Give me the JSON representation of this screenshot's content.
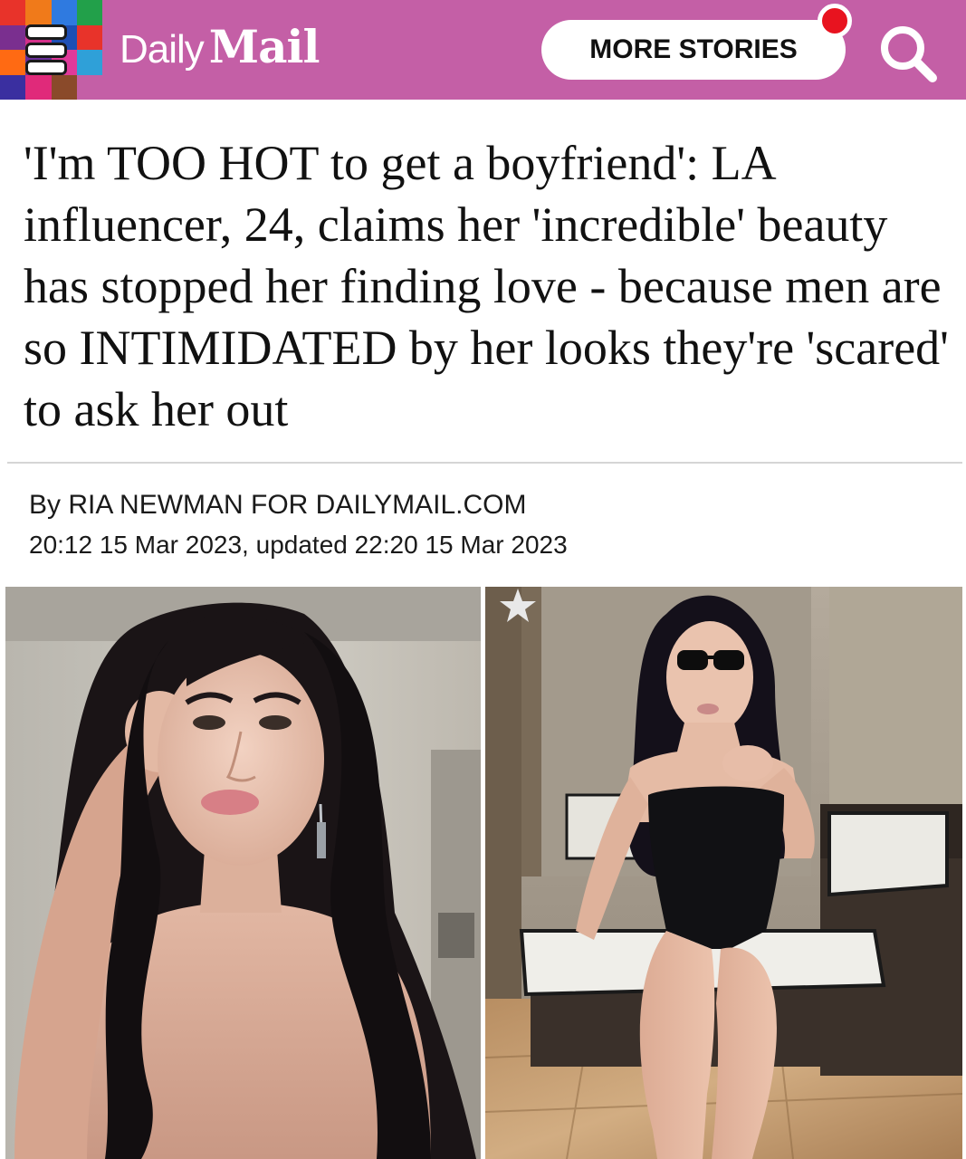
{
  "header": {
    "logo_part1": "Daily",
    "logo_part2": "Mail",
    "more_stories_label": "MORE STORIES",
    "menu_colors": [
      "#e8332a",
      "#f07a1a",
      "#2f7ae0",
      "#22a04a",
      "#7a2f8f",
      "#d4308a",
      "#1e4fb5",
      "#e8332a",
      "#ff6a13",
      "#6a2f9a",
      "#e03a9a",
      "#2fa0d8",
      "#3a2fa0",
      "#e02a7a",
      "#8a4a2a",
      "#c45fa6"
    ],
    "bar_color": "#c45fa6",
    "notification_color": "#e8131f"
  },
  "article": {
    "headline": "'I'm TOO HOT to get a boyfriend': LA influencer, 24, claims her 'incredible' beauty has stopped her finding love - because men are so INTIMIDATED by her looks they're 'scared' to ask her out",
    "byline": "By RIA NEWMAN FOR DAILYMAIL.COM",
    "timestamp": "20:12 15 Mar 2023, updated 22:20 15 Mar 2023"
  }
}
